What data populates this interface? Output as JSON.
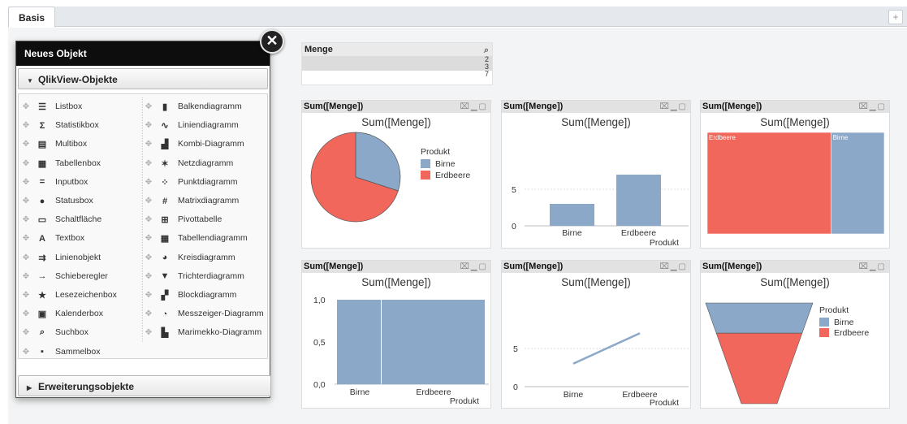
{
  "tabs": [
    {
      "label": "Basis"
    }
  ],
  "tab_add_label": "+",
  "panel": {
    "title": "Neues Objekt",
    "close_label": "✕",
    "section1": "QlikView-Objekte",
    "section2": "Erweiterungsobjekte",
    "col1": [
      {
        "label": "Listbox",
        "icon": "list-icon",
        "glyph": "☰"
      },
      {
        "label": "Statistikbox",
        "icon": "sigma-icon",
        "glyph": "Σ"
      },
      {
        "label": "Multibox",
        "icon": "multibox-icon",
        "glyph": "▤"
      },
      {
        "label": "Tabellenbox",
        "icon": "table-icon",
        "glyph": "▦"
      },
      {
        "label": "Inputbox",
        "icon": "equals-icon",
        "glyph": "="
      },
      {
        "label": "Statusbox",
        "icon": "status-icon",
        "glyph": "●"
      },
      {
        "label": "Schaltfläche",
        "icon": "button-icon",
        "glyph": "▭"
      },
      {
        "label": "Textbox",
        "icon": "text-icon",
        "glyph": "A"
      },
      {
        "label": "Linienobjekt",
        "icon": "line-object-icon",
        "glyph": "⇉"
      },
      {
        "label": "Schieberegler",
        "icon": "slider-icon",
        "glyph": "→"
      },
      {
        "label": "Lesezeichenbox",
        "icon": "bookmark-star-icon",
        "glyph": "★"
      },
      {
        "label": "Kalenderbox",
        "icon": "calendar-icon",
        "glyph": "▣"
      },
      {
        "label": "Suchbox",
        "icon": "search-icon",
        "glyph": "⌕"
      },
      {
        "label": "Sammelbox",
        "icon": "container-icon",
        "glyph": "▪"
      }
    ],
    "col2": [
      {
        "label": "Balkendiagramm",
        "icon": "bar-chart-icon",
        "glyph": "▮"
      },
      {
        "label": "Liniendiagramm",
        "icon": "line-chart-icon",
        "glyph": "∿"
      },
      {
        "label": "Kombi-Diagramm",
        "icon": "combo-chart-icon",
        "glyph": "▟"
      },
      {
        "label": "Netzdiagramm",
        "icon": "radar-chart-icon",
        "glyph": "✶"
      },
      {
        "label": "Punktdiagramm",
        "icon": "scatter-chart-icon",
        "glyph": "⁘"
      },
      {
        "label": "Matrixdiagramm",
        "icon": "grid-chart-icon",
        "glyph": "#"
      },
      {
        "label": "Pivottabelle",
        "icon": "pivot-table-icon",
        "glyph": "⊞"
      },
      {
        "label": "Tabellendiagramm",
        "icon": "straight-table-icon",
        "glyph": "▦"
      },
      {
        "label": "Kreisdiagramm",
        "icon": "pie-chart-icon",
        "glyph": "◕"
      },
      {
        "label": "Trichterdiagramm",
        "icon": "funnel-chart-icon",
        "glyph": "▼"
      },
      {
        "label": "Blockdiagramm",
        "icon": "block-chart-icon",
        "glyph": "▞"
      },
      {
        "label": "Messzeiger-Diagramm",
        "icon": "gauge-chart-icon",
        "glyph": "◔"
      },
      {
        "label": "Marimekko-Diagramm",
        "icon": "mekko-chart-icon",
        "glyph": "▙"
      }
    ]
  },
  "menge": {
    "title": "Menge",
    "values": [
      "2",
      "3",
      "7"
    ]
  },
  "colors": {
    "birne": "#8ba8c8",
    "erdbeere": "#f2675b"
  },
  "charts": [
    {
      "id": "pie",
      "caption": "Sum([Menge])",
      "title": "Sum([Menge])",
      "legend_title": "Produkt",
      "legend": [
        "Birne",
        "Erdbeere"
      ]
    },
    {
      "id": "bar",
      "caption": "Sum([Menge])",
      "title": "Sum([Menge])",
      "xlabel": "Produkt",
      "ticks": [
        "0",
        "5"
      ]
    },
    {
      "id": "block",
      "caption": "Sum([Menge])",
      "title": "Sum([Menge])",
      "labels": [
        "Erdbeere",
        "Birne"
      ]
    },
    {
      "id": "mekko",
      "caption": "Sum([Menge])",
      "title": "Sum([Menge])",
      "xlabel": "Produkt",
      "ticks": [
        "0,0",
        "0,5",
        "1,0"
      ]
    },
    {
      "id": "line",
      "caption": "Sum([Menge])",
      "title": "Sum([Menge])",
      "xlabel": "Produkt",
      "ticks": [
        "0",
        "5"
      ]
    },
    {
      "id": "funnel",
      "caption": "Sum([Menge])",
      "title": "Sum([Menge])",
      "legend_title": "Produkt",
      "legend": [
        "Birne",
        "Erdbeere"
      ]
    }
  ],
  "chart_data": [
    {
      "type": "pie",
      "title": "Sum([Menge])",
      "legend_title": "Produkt",
      "categories": [
        "Birne",
        "Erdbeere"
      ],
      "values": [
        3,
        7
      ]
    },
    {
      "type": "bar",
      "title": "Sum([Menge])",
      "xlabel": "Produkt",
      "categories": [
        "Birne",
        "Erdbeere"
      ],
      "values": [
        3,
        7
      ],
      "ylim": [
        0,
        10
      ]
    },
    {
      "type": "heatmap",
      "title": "Sum([Menge])",
      "categories": [
        "Erdbeere",
        "Birne"
      ],
      "values": [
        7,
        3
      ]
    },
    {
      "type": "bar",
      "title": "Sum([Menge])",
      "xlabel": "Produkt",
      "categories": [
        "Birne",
        "Erdbeere"
      ],
      "values": [
        1,
        1
      ],
      "ylim": [
        0,
        1
      ]
    },
    {
      "type": "line",
      "title": "Sum([Menge])",
      "xlabel": "Produkt",
      "categories": [
        "Birne",
        "Erdbeere"
      ],
      "values": [
        3,
        7
      ],
      "ylim": [
        0,
        10
      ]
    },
    {
      "type": "area",
      "title": "Sum([Menge])",
      "legend_title": "Produkt",
      "categories": [
        "Birne",
        "Erdbeere"
      ],
      "values": [
        3,
        7
      ]
    }
  ]
}
